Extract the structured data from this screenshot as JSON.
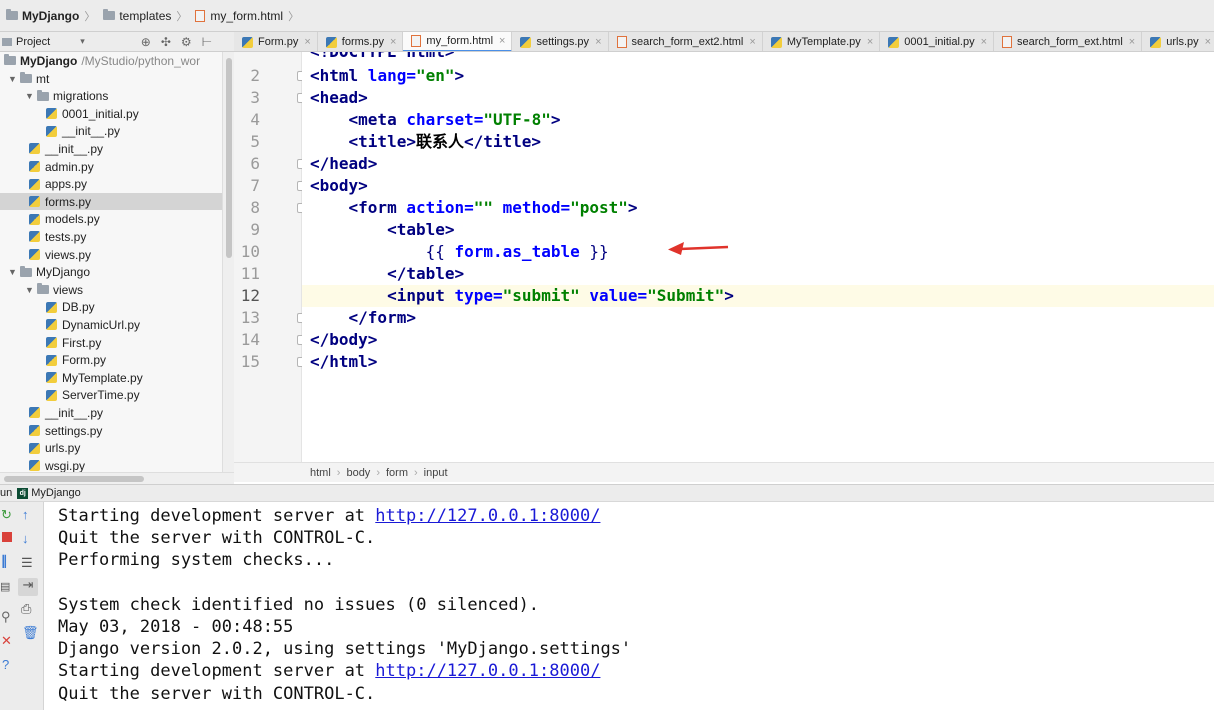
{
  "breadcrumbs": [
    "MyDjango",
    "templates",
    "my_form.html"
  ],
  "project_toolbar": {
    "label": "Project"
  },
  "tabs": [
    {
      "label": "Form.py",
      "type": "py",
      "active": false
    },
    {
      "label": "forms.py",
      "type": "py",
      "active": false
    },
    {
      "label": "my_form.html",
      "type": "html",
      "active": true
    },
    {
      "label": "settings.py",
      "type": "py",
      "active": false
    },
    {
      "label": "search_form_ext2.html",
      "type": "html",
      "active": false
    },
    {
      "label": "MyTemplate.py",
      "type": "py",
      "active": false
    },
    {
      "label": "0001_initial.py",
      "type": "py",
      "active": false
    },
    {
      "label": "search_form_ext.html",
      "type": "html",
      "active": false
    },
    {
      "label": "urls.py",
      "type": "py",
      "active": false
    }
  ],
  "tree": {
    "root": {
      "label": "MyDjango",
      "path": "/MyStudio/python_wor"
    },
    "items": [
      {
        "label": "mt",
        "kind": "folder",
        "depth": 0,
        "expanded": true
      },
      {
        "label": "migrations",
        "kind": "folder",
        "depth": 1,
        "expanded": true
      },
      {
        "label": "0001_initial.py",
        "kind": "py",
        "depth": 2
      },
      {
        "label": "__init__.py",
        "kind": "py",
        "depth": 2
      },
      {
        "label": "__init__.py",
        "kind": "py",
        "depth": 1
      },
      {
        "label": "admin.py",
        "kind": "py",
        "depth": 1
      },
      {
        "label": "apps.py",
        "kind": "py",
        "depth": 1
      },
      {
        "label": "forms.py",
        "kind": "py",
        "depth": 1,
        "selected": true
      },
      {
        "label": "models.py",
        "kind": "py",
        "depth": 1
      },
      {
        "label": "tests.py",
        "kind": "py",
        "depth": 1
      },
      {
        "label": "views.py",
        "kind": "py",
        "depth": 1
      },
      {
        "label": "MyDjango",
        "kind": "folder",
        "depth": 0,
        "expanded": true
      },
      {
        "label": "views",
        "kind": "folder",
        "depth": 1,
        "expanded": true
      },
      {
        "label": "DB.py",
        "kind": "py",
        "depth": 2
      },
      {
        "label": "DynamicUrl.py",
        "kind": "py",
        "depth": 2
      },
      {
        "label": "First.py",
        "kind": "py",
        "depth": 2
      },
      {
        "label": "Form.py",
        "kind": "py",
        "depth": 2
      },
      {
        "label": "MyTemplate.py",
        "kind": "py",
        "depth": 2
      },
      {
        "label": "ServerTime.py",
        "kind": "py",
        "depth": 2
      },
      {
        "label": "__init__.py",
        "kind": "py",
        "depth": 1
      },
      {
        "label": "settings.py",
        "kind": "py",
        "depth": 1
      },
      {
        "label": "urls.py",
        "kind": "py",
        "depth": 1
      },
      {
        "label": "wsgi.py",
        "kind": "py",
        "depth": 1
      }
    ]
  },
  "editor": {
    "line_numbers": [
      "2",
      "3",
      "4",
      "5",
      "6",
      "7",
      "8",
      "9",
      "10",
      "11",
      "12",
      "13",
      "14",
      "15"
    ],
    "partial_top_line": "<!DOCTYPE html>",
    "code": {
      "l2": {
        "open": "<html",
        "attr": " lang=",
        "val": "\"en\"",
        "close": ">"
      },
      "l3": "<head>",
      "l4": {
        "open": "<meta",
        "attr": " charset=",
        "val": "\"UTF-8\"",
        "close": ">"
      },
      "l5": {
        "open": "<title>",
        "text": "联系人",
        "close": "</title>"
      },
      "l6": "</head>",
      "l7": "<body>",
      "l8": {
        "open": "<form",
        "attr1": " action=",
        "val1": "\"\"",
        "attr2": " method=",
        "val2": "\"post\"",
        "close": ">"
      },
      "l9": "<table>",
      "l10": {
        "lbrace": "{{ ",
        "expr": "form.as_table",
        "rbrace": " }}"
      },
      "l11": "</table>",
      "l12": {
        "open": "<input",
        "attr1": " type=",
        "val1": "\"submit\"",
        "attr2": " value=",
        "val2": "\"Submit\"",
        "close": ">"
      },
      "l13": "</form>",
      "l14": "</body>",
      "l15": "</html>"
    },
    "current_line": "12"
  },
  "editor_breadcrumbs": [
    "html",
    "body",
    "form",
    "input"
  ],
  "run": {
    "label": "un",
    "config": "MyDjango",
    "console": [
      {
        "text": "Starting development server at ",
        "link": "http://127.0.0.1:8000/"
      },
      {
        "text": "Quit the server with CONTROL-C."
      },
      {
        "text": "Performing system checks..."
      },
      {
        "text": ""
      },
      {
        "text": "System check identified no issues (0 silenced)."
      },
      {
        "text": "May 03, 2018 - 00:48:55"
      },
      {
        "text": "Django version 2.0.2, using settings 'MyDjango.settings'"
      },
      {
        "text": "Starting development server at ",
        "link": "http://127.0.0.1:8000/"
      },
      {
        "text": "Quit the server with CONTROL-C."
      }
    ]
  },
  "colors": {
    "tag": "#000080",
    "attr": "#0000ff",
    "string": "#008000",
    "link": "#1a1ad6",
    "current_line": "#fefbe6",
    "tab_active_underline": "#4a8fe7"
  }
}
